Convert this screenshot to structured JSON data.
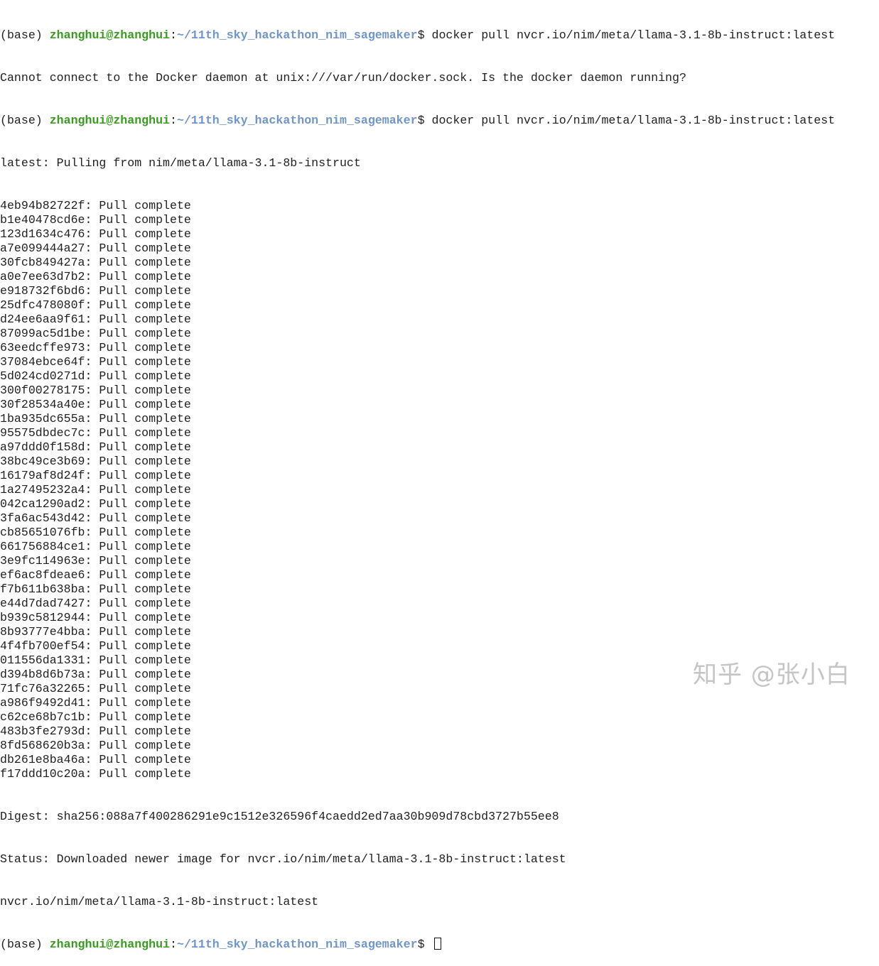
{
  "prompt": {
    "env": "(base) ",
    "user_host": "zhanghui@zhanghui",
    "sep": ":",
    "path": "~/11th_sky_hackathon_nim_sagemaker",
    "dollar": "$ "
  },
  "command": "docker pull nvcr.io/nim/meta/llama-3.1-8b-instruct:latest",
  "error_line": "Cannot connect to the Docker daemon at unix:///var/run/docker.sock. Is the docker daemon running?",
  "pulling_line": "latest: Pulling from nim/meta/llama-3.1-8b-instruct",
  "layer_status": ": Pull complete",
  "layers": [
    "4eb94b82722f",
    "b1e40478cd6e",
    "123d1634c476",
    "a7e099444a27",
    "30fcb849427a",
    "a0e7ee63d7b2",
    "e918732f6bd6",
    "25dfc478080f",
    "d24ee6aa9f61",
    "87099ac5d1be",
    "63eedcffe973",
    "37084ebce64f",
    "5d024cd0271d",
    "300f00278175",
    "30f28534a40e",
    "1ba935dc655a",
    "95575dbdec7c",
    "a97ddd0f158d",
    "38bc49ce3b69",
    "16179af8d24f",
    "1a27495232a4",
    "042ca1290ad2",
    "3fa6ac543d42",
    "cb85651076fb",
    "661756884ce1",
    "3e9fc114963e",
    "ef6ac8fdeae6",
    "f7b611b638ba",
    "e44d7dad7427",
    "b939c5812944",
    "8b93777e4bba",
    "4f4fb700ef54",
    "011556da1331",
    "d394b8d6b73a",
    "71fc76a32265",
    "a986f9492d41",
    "c62ce68b7c1b",
    "483b3fe2793d",
    "8fd568620b3a",
    "db261e8ba46a",
    "f17ddd10c20a"
  ],
  "digest_line": "Digest: sha256:088a7f400286291e9c1512e326596f4caedd2ed7aa30b909d78cbd3727b55ee8",
  "status_line": "Status: Downloaded newer image for nvcr.io/nim/meta/llama-3.1-8b-instruct:latest",
  "image_line": "nvcr.io/nim/meta/llama-3.1-8b-instruct:latest",
  "watermark": "知乎 @张小白"
}
